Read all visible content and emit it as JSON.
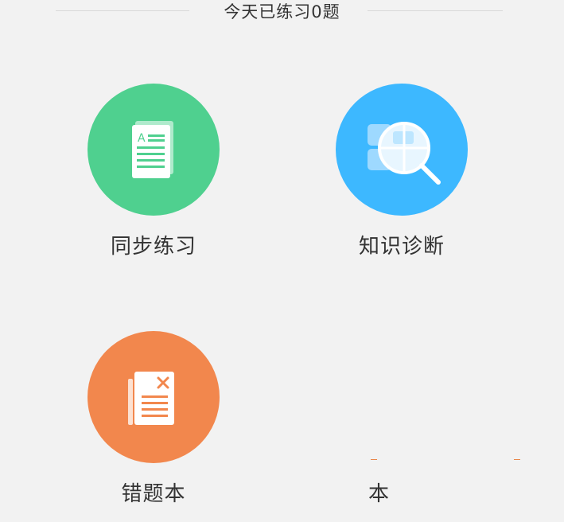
{
  "header": {
    "title": "今天已练习0题"
  },
  "tiles": [
    {
      "id": "practice",
      "label": "同步练习",
      "icon": "document-icon",
      "color": "#4fd08f"
    },
    {
      "id": "diagnosis",
      "label": "知识诊断",
      "icon": "magnifier-icon",
      "color": "#3db8ff"
    },
    {
      "id": "mistakes",
      "label": "错题本",
      "icon": "wrong-answer-book-icon",
      "color": "#f2874d"
    }
  ],
  "partial_tile": {
    "label": "本"
  }
}
